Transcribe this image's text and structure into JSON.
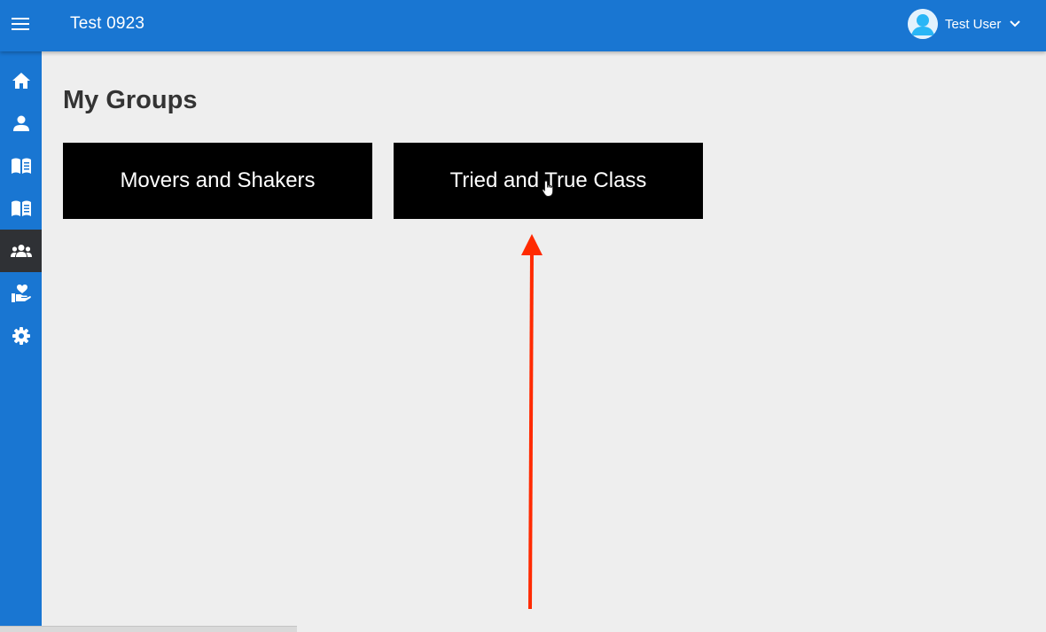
{
  "header": {
    "title": "Test 0923",
    "user_name": "Test User"
  },
  "sidebar": {
    "items": [
      {
        "icon": "home-icon"
      },
      {
        "icon": "person-icon"
      },
      {
        "icon": "book-icon"
      },
      {
        "icon": "book-icon"
      },
      {
        "icon": "groups-icon",
        "active": true
      },
      {
        "icon": "volunteer-icon"
      },
      {
        "icon": "settings-icon"
      }
    ]
  },
  "main": {
    "title": "My Groups",
    "groups": [
      {
        "label": "Movers and Shakers"
      },
      {
        "label": "Tried and True Class"
      }
    ]
  },
  "colors": {
    "primary": "#1976d2",
    "active_nav": "#2f3135",
    "card": "#000000",
    "background": "#eeeeee",
    "annotation": "#ff2a00"
  }
}
